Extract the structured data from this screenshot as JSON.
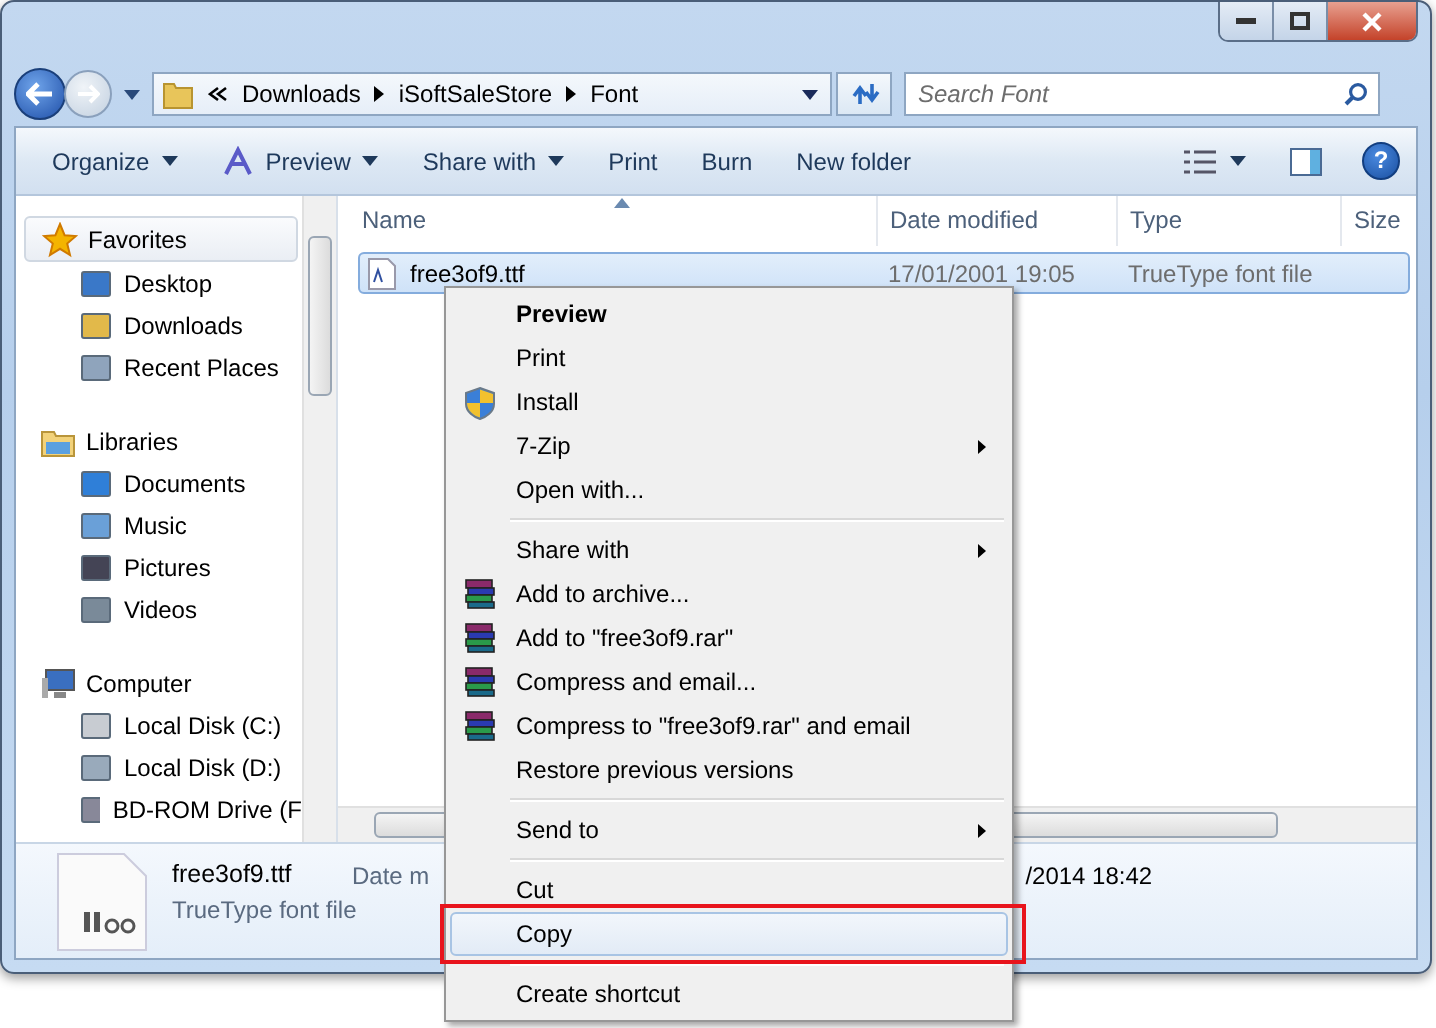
{
  "address": {
    "crumbs": [
      "Downloads",
      "iSoftSaleStore",
      "Font"
    ]
  },
  "search": {
    "placeholder": "Search Font"
  },
  "toolbar": [
    {
      "label": "Organize",
      "dropdown": true
    },
    {
      "label": "Preview",
      "dropdown": true
    },
    {
      "label": "Share with",
      "dropdown": true
    },
    {
      "label": "Print",
      "dropdown": false
    },
    {
      "label": "Burn",
      "dropdown": false
    },
    {
      "label": "New folder",
      "dropdown": false
    }
  ],
  "help_button": {
    "label": "?"
  },
  "sidebar": {
    "groups": [
      {
        "label": "Favorites",
        "selected": true,
        "children": [
          {
            "label": "Desktop",
            "selected": false
          },
          {
            "label": "Downloads",
            "selected": false
          },
          {
            "label": "Recent Places",
            "selected": false
          }
        ]
      },
      {
        "label": "Libraries",
        "selected": false,
        "children": [
          {
            "label": "Documents",
            "selected": false
          },
          {
            "label": "Music",
            "selected": false
          },
          {
            "label": "Pictures",
            "selected": false
          },
          {
            "label": "Videos",
            "selected": false
          }
        ]
      },
      {
        "label": "Computer",
        "selected": false,
        "children": [
          {
            "label": "Local Disk (C:)",
            "selected": false
          },
          {
            "label": "Local Disk (D:)",
            "selected": false
          },
          {
            "label": "BD-ROM Drive (F",
            "selected": false
          }
        ]
      }
    ]
  },
  "file_list": {
    "columns": [
      "Name",
      "Date modified",
      "Type",
      "Size"
    ],
    "rows": [
      {
        "name": "free3of9.ttf",
        "date_modified": "17/01/2001 19:05",
        "type": "TrueType font file",
        "selected": true
      }
    ]
  },
  "details": {
    "name": "free3of9.ttf",
    "type": "TrueType font file",
    "date_label": "Date m",
    "date_value": "/2014 18:42"
  },
  "context_menu": {
    "highlight_box": true,
    "groups": [
      [
        {
          "label": "Preview",
          "kind": "plain",
          "default": true,
          "submenu": false,
          "selected": false
        },
        {
          "label": "Print",
          "kind": "plain",
          "default": false,
          "submenu": false,
          "selected": false
        },
        {
          "label": "Install",
          "kind": "shield",
          "default": false,
          "submenu": false,
          "selected": false
        },
        {
          "label": "7-Zip",
          "kind": "plain",
          "default": false,
          "submenu": true,
          "selected": false
        },
        {
          "label": "Open with...",
          "kind": "plain",
          "default": false,
          "submenu": false,
          "selected": false
        }
      ],
      [
        {
          "label": "Share with",
          "kind": "plain",
          "default": false,
          "submenu": true,
          "selected": false
        },
        {
          "label": "Add to archive...",
          "kind": "archive",
          "default": false,
          "submenu": false,
          "selected": false
        },
        {
          "label": "Add to \"free3of9.rar\"",
          "kind": "archive",
          "default": false,
          "submenu": false,
          "selected": false
        },
        {
          "label": "Compress and email...",
          "kind": "archive",
          "default": false,
          "submenu": false,
          "selected": false
        },
        {
          "label": "Compress to \"free3of9.rar\" and email",
          "kind": "archive",
          "default": false,
          "submenu": false,
          "selected": false
        },
        {
          "label": "Restore previous versions",
          "kind": "plain",
          "default": false,
          "submenu": false,
          "selected": false
        }
      ],
      [
        {
          "label": "Send to",
          "kind": "plain",
          "default": false,
          "submenu": true,
          "selected": false
        }
      ],
      [
        {
          "label": "Cut",
          "kind": "plain",
          "default": false,
          "submenu": false,
          "selected": false
        },
        {
          "label": "Copy",
          "kind": "plain",
          "default": false,
          "submenu": false,
          "selected": true
        }
      ],
      [
        {
          "label": "Create shortcut",
          "kind": "plain",
          "default": false,
          "submenu": false,
          "selected": false
        }
      ]
    ]
  }
}
